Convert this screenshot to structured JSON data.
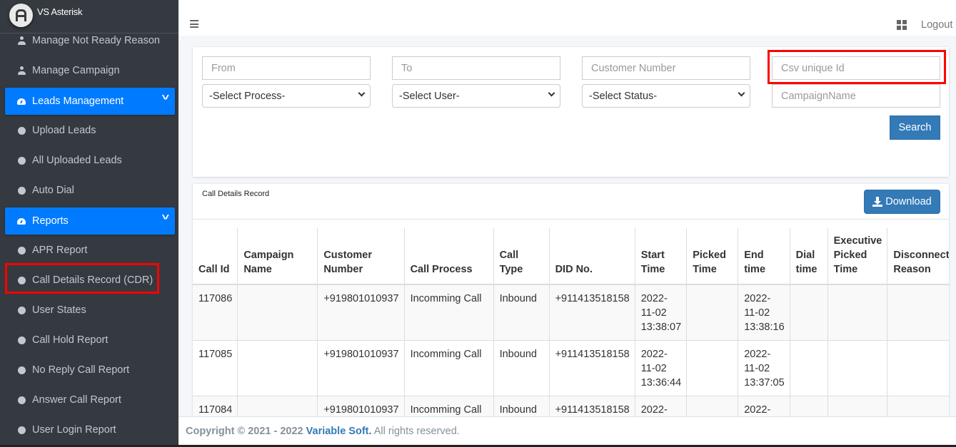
{
  "brand": {
    "name": "VS Asterisk",
    "logo_icon": "asterisk-logo-icon"
  },
  "sidebar": {
    "items": [
      {
        "label": "Manage Not Ready Reason",
        "icon": "user-icon",
        "type": "item"
      },
      {
        "label": "Manage Campaign",
        "icon": "user-icon",
        "type": "item"
      },
      {
        "label": "Leads Management",
        "icon": "dashboard-icon",
        "type": "group",
        "expanded": true
      },
      {
        "label": "Upload Leads",
        "icon": "circle-icon",
        "type": "item"
      },
      {
        "label": "All Uploaded Leads",
        "icon": "circle-icon",
        "type": "item"
      },
      {
        "label": "Auto Dial",
        "icon": "circle-icon",
        "type": "item"
      },
      {
        "label": "Reports",
        "icon": "dashboard-icon",
        "type": "group",
        "expanded": true
      },
      {
        "label": "APR Report",
        "icon": "circle-icon",
        "type": "item"
      },
      {
        "label": "Call Details Record (CDR)",
        "icon": "circle-icon",
        "type": "item",
        "highlighted": true
      },
      {
        "label": "User States",
        "icon": "circle-icon",
        "type": "item"
      },
      {
        "label": "Call Hold Report",
        "icon": "circle-icon",
        "type": "item"
      },
      {
        "label": "No Reply Call Report",
        "icon": "circle-icon",
        "type": "item"
      },
      {
        "label": "Answer Call Report",
        "icon": "circle-icon",
        "type": "item"
      },
      {
        "label": "User Login Report",
        "icon": "circle-icon",
        "type": "item"
      }
    ]
  },
  "topbar": {
    "menu_icon": "hamburger-icon",
    "apps_icon": "grid-icon",
    "logout_label": "Logout"
  },
  "filters": {
    "from": {
      "placeholder": "From",
      "value": ""
    },
    "to": {
      "placeholder": "To",
      "value": ""
    },
    "customer_number": {
      "placeholder": "Customer Number",
      "value": ""
    },
    "csv_unique_id": {
      "placeholder": "Csv unique Id",
      "value": "",
      "highlighted": true
    },
    "process": {
      "selected": "-Select Process-"
    },
    "user": {
      "selected": "-Select User-"
    },
    "status": {
      "selected": "-Select Status-"
    },
    "campaign_name": {
      "placeholder": "CampaignName",
      "value": ""
    },
    "search_label": "Search"
  },
  "cdr": {
    "title": "Call Details Record",
    "download_label": "Download",
    "columns": [
      [
        "Call Id"
      ],
      [
        "Campaign",
        "Name"
      ],
      [
        "Customer",
        "Number"
      ],
      [
        "Call Process"
      ],
      [
        "Call Type"
      ],
      [
        "DID No."
      ],
      [
        "Start",
        "Time"
      ],
      [
        "Picked",
        "Time"
      ],
      [
        "End",
        "time"
      ],
      [
        "Dial",
        "time"
      ],
      [
        "Executive",
        "Picked",
        "Time"
      ],
      [
        "Disconnected",
        "Reason"
      ]
    ],
    "rows": [
      {
        "call_id": "117086",
        "campaign_name": "",
        "customer_number": "+919801010937",
        "call_process": "Incomming Call",
        "call_type": "Inbound",
        "did_no": "+911413518158",
        "start_time": [
          "2022-",
          "11-02",
          "13:38:07"
        ],
        "picked_time": "",
        "end_time": [
          "2022-",
          "11-02",
          "13:38:16"
        ],
        "dial_time": "",
        "executive_picked_time": "",
        "disconnected_reason": ""
      },
      {
        "call_id": "117085",
        "campaign_name": "",
        "customer_number": "+919801010937",
        "call_process": "Incomming Call",
        "call_type": "Inbound",
        "did_no": "+911413518158",
        "start_time": [
          "2022-",
          "11-02",
          "13:36:44"
        ],
        "picked_time": "",
        "end_time": [
          "2022-",
          "11-02",
          "13:37:05"
        ],
        "dial_time": "",
        "executive_picked_time": "",
        "disconnected_reason": ""
      },
      {
        "call_id": "117084",
        "campaign_name": "",
        "customer_number": "+919801010937",
        "call_process": "Incomming Call",
        "call_type": "Inbound",
        "did_no": "+911413518158",
        "start_time": [
          "2022-"
        ],
        "picked_time": "",
        "end_time": [
          "2022-"
        ],
        "dial_time": "",
        "executive_picked_time": "",
        "disconnected_reason": ""
      }
    ]
  },
  "footer": {
    "prefix": "Copyright © 2021 - 2022",
    "company": "Variable Soft.",
    "suffix": "All rights reserved."
  },
  "colors": {
    "sidebar_bg": "#343a40",
    "active_blue": "#007bff",
    "button_blue": "#337ab7",
    "highlight_red": "#ff0000"
  }
}
